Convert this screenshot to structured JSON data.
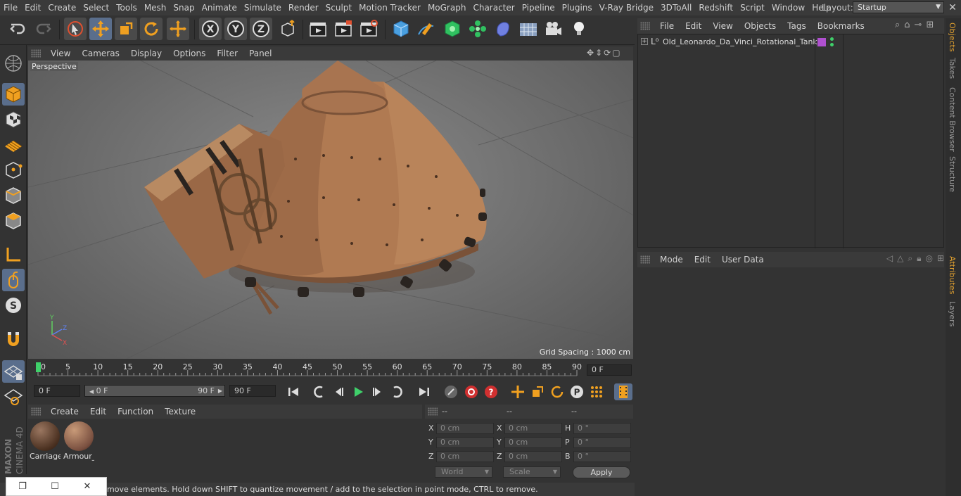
{
  "menubar": {
    "items": [
      "File",
      "Edit",
      "Create",
      "Select",
      "Tools",
      "Mesh",
      "Snap",
      "Animate",
      "Simulate",
      "Render",
      "Sculpt",
      "Motion Tracker",
      "MoGraph",
      "Character",
      "Pipeline",
      "Plugins",
      "V-Ray Bridge",
      "3DToAll",
      "Redshift",
      "Script",
      "Window",
      "Help"
    ],
    "layout_label": "Layout:",
    "layout_value": "Startup"
  },
  "viewport": {
    "menu": [
      "View",
      "Cameras",
      "Display",
      "Options",
      "Filter",
      "Panel"
    ],
    "label": "Perspective",
    "grid_spacing": "Grid Spacing : 1000 cm"
  },
  "timeline": {
    "ticks": [
      "0",
      "5",
      "10",
      "15",
      "20",
      "25",
      "30",
      "35",
      "40",
      "45",
      "50",
      "55",
      "60",
      "65",
      "70",
      "75",
      "80",
      "85",
      "90"
    ],
    "current_frame": "0 F"
  },
  "transport": {
    "start_field": "0 F",
    "range_start": "0 F",
    "range_end": "90 F",
    "end_field": "90 F"
  },
  "materials": {
    "menu": [
      "Create",
      "Edit",
      "Function",
      "Texture"
    ],
    "items": [
      {
        "name": "Carriage"
      },
      {
        "name": "Armour_"
      }
    ]
  },
  "coordinates": {
    "headers": [
      "--",
      "--",
      "--"
    ],
    "rows": [
      {
        "l1": "X",
        "v1": "0 cm",
        "l2": "X",
        "v2": "0 cm",
        "l3": "H",
        "v3": "0 °"
      },
      {
        "l1": "Y",
        "v1": "0 cm",
        "l2": "Y",
        "v2": "0 cm",
        "l3": "P",
        "v3": "0 °"
      },
      {
        "l1": "Z",
        "v1": "0 cm",
        "l2": "Z",
        "v2": "0 cm",
        "l3": "B",
        "v3": "0 °"
      }
    ],
    "space": "World",
    "mode": "Scale",
    "apply": "Apply"
  },
  "status": {
    "text": "move elements. Hold down SHIFT to quantize movement / add to the selection in point mode, CTRL to remove."
  },
  "objects": {
    "menu": [
      "File",
      "Edit",
      "View",
      "Objects",
      "Tags",
      "Bookmarks"
    ],
    "items": [
      {
        "name": "Old_Leonardo_Da_Vinci_Rotational_Tank",
        "tag_color": "#b050d0"
      }
    ]
  },
  "attributes": {
    "menu": [
      "Mode",
      "Edit",
      "User Data"
    ]
  },
  "right_tabs": [
    "Objects",
    "Takes",
    "Content Browser",
    "Structure",
    "Attributes",
    "Layers"
  ],
  "brand": {
    "vertical_text": "MAXON CINEMA 4D"
  },
  "colors": {
    "accent": "#e0a030",
    "selected_tool": "#5a6e8c",
    "playhead": "#3fd06a"
  }
}
